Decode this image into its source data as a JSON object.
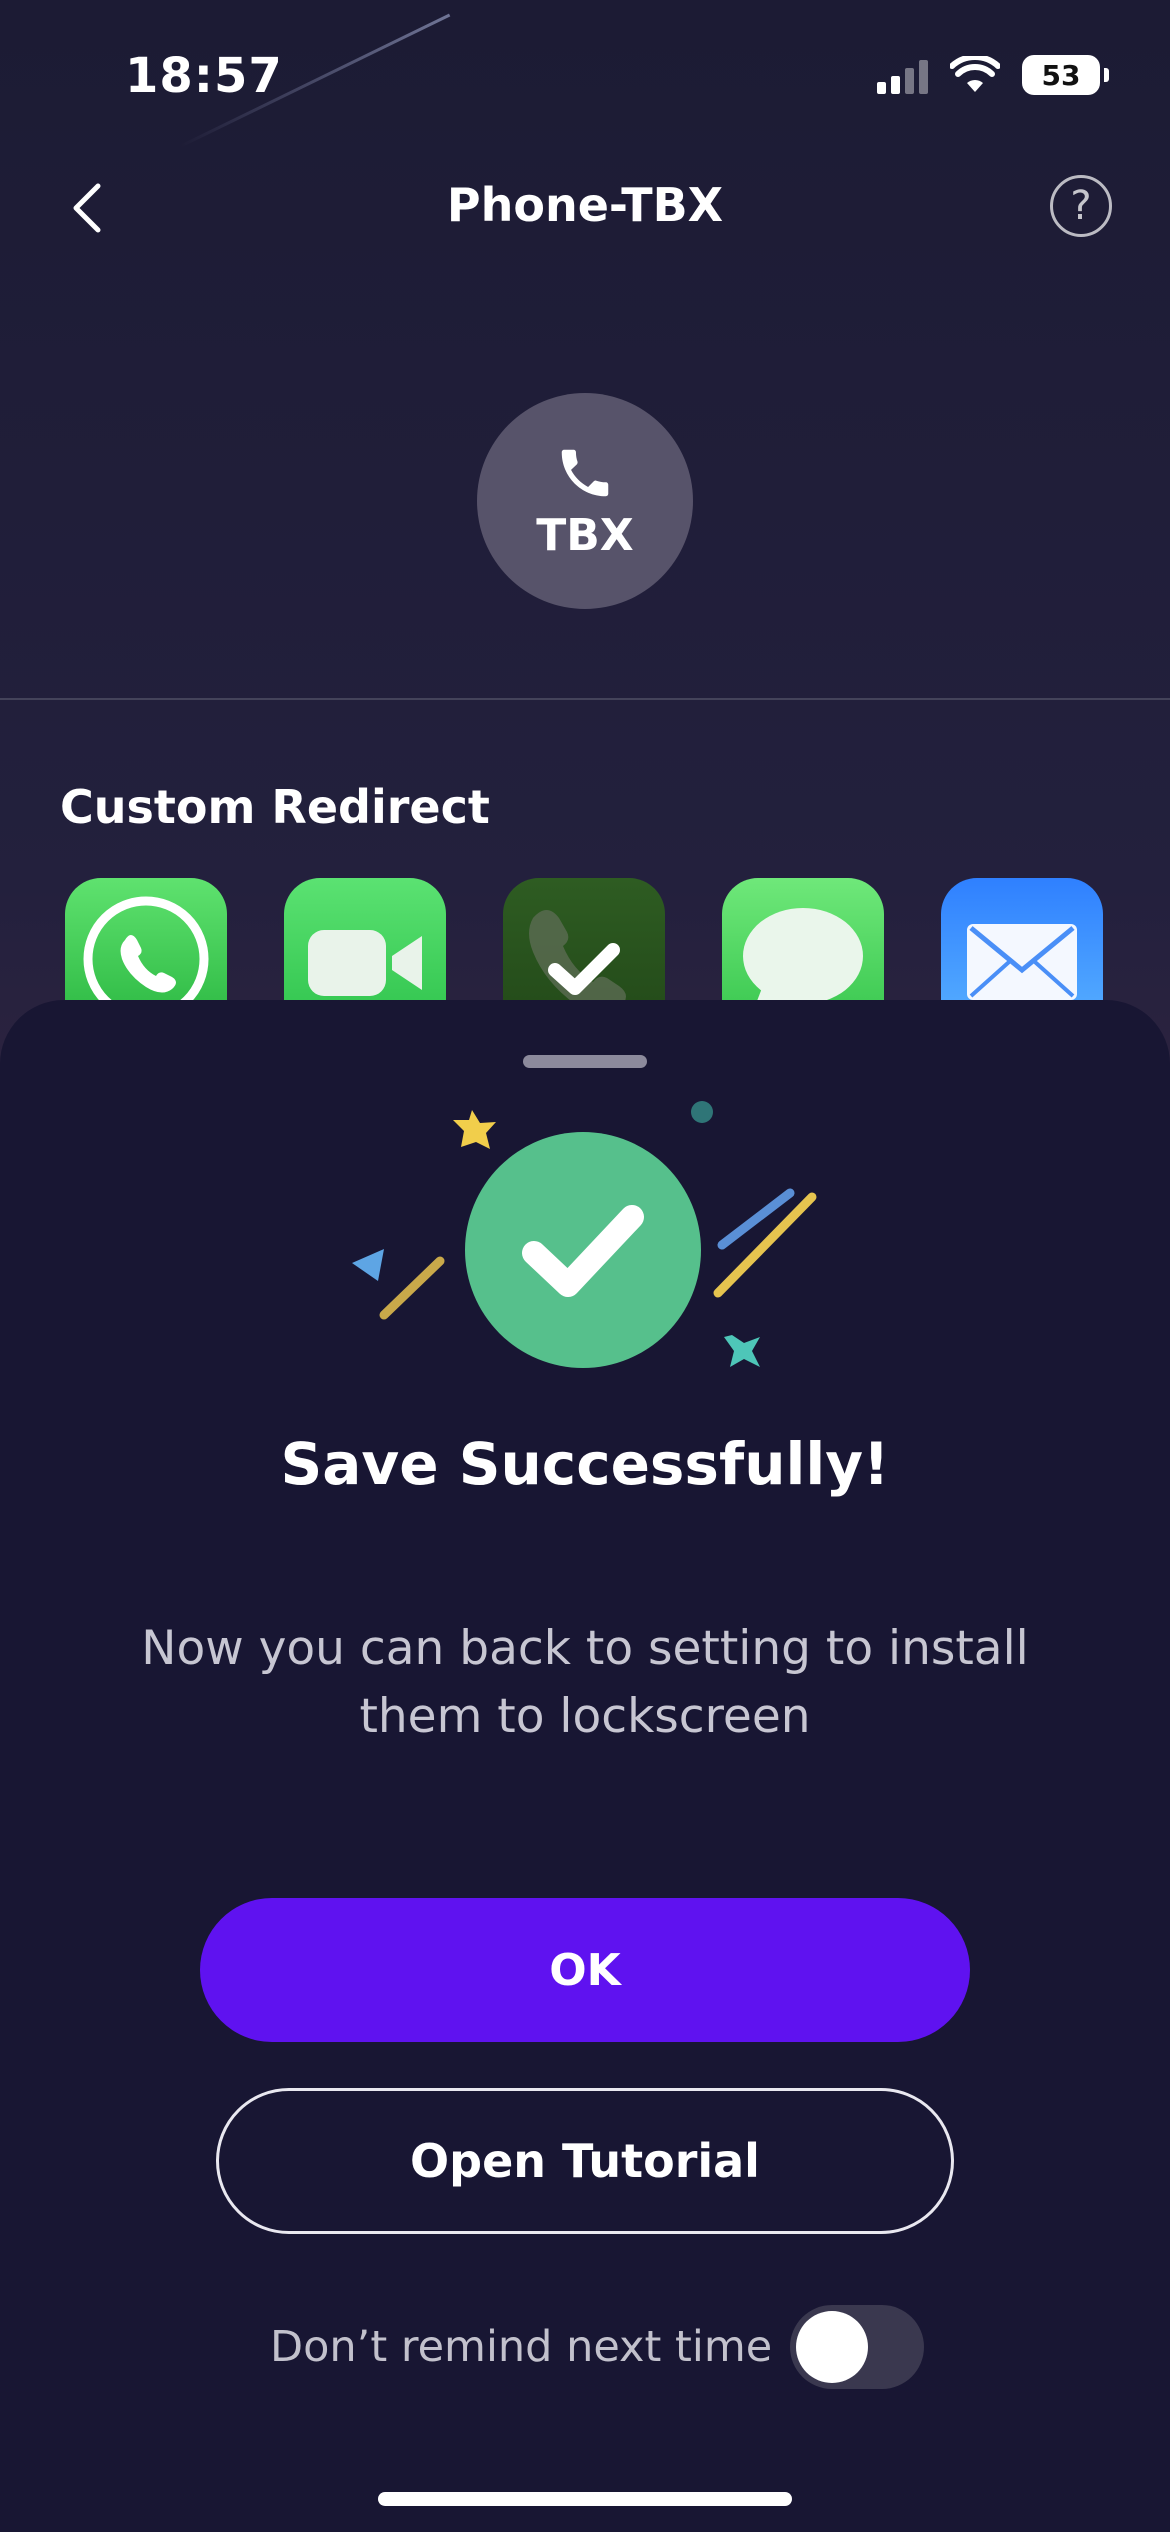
{
  "status_bar": {
    "time": "18:57",
    "battery": "53"
  },
  "header": {
    "title": "Phone-TBX",
    "back_icon": "chevron-left-icon",
    "help_icon": "question-mark-icon"
  },
  "contact": {
    "label": "TBX",
    "icon": "phone-icon"
  },
  "redirect": {
    "title": "Custom Redirect",
    "apps": [
      "whatsapp-icon",
      "facetime-icon",
      "phone-check-icon",
      "messages-icon",
      "mail-icon"
    ]
  },
  "sheet": {
    "title": "Save Successfully!",
    "message": "Now you can back to setting to install them to lockscreen",
    "ok_label": "OK",
    "tutorial_label": "Open Tutorial",
    "remind_label": "Don’t remind next time",
    "remind_toggle_on": false,
    "colors": {
      "primary": "#5f12f0",
      "success": "#56c08c",
      "sheet_bg": "#181633"
    }
  }
}
